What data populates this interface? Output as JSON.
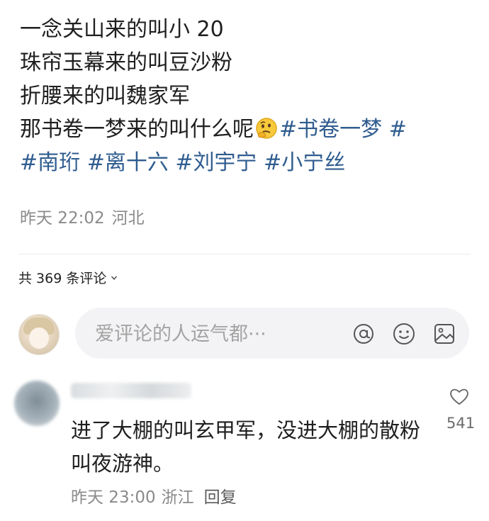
{
  "post": {
    "line1": "一念关山来的叫小 20",
    "line2": "珠帘玉幕来的叫豆沙粉",
    "line3": "折腰来的叫魏家军",
    "line4_text": "那书卷一梦来的叫什么呢",
    "tags": [
      "#书卷一梦",
      "#南珩",
      "#离十六",
      "#刘宇宁",
      "#小宁丝"
    ],
    "date": "昨天 22:02",
    "location": "河北"
  },
  "comments_header": {
    "count_label": "共 369 条评论"
  },
  "comment_input": {
    "placeholder": "爱评论的人运气都···"
  },
  "comment": {
    "text": "进了大棚的叫玄甲军，没进大棚的散粉叫夜游神。",
    "time": "昨天 23:00",
    "location": "浙江",
    "reply_label": "回复",
    "likes": "541"
  },
  "icons": {
    "emoji": "thinking-face-icon",
    "mention": "at-icon",
    "smile": "smile-icon",
    "image": "image-icon",
    "like": "heart-icon",
    "chevron": "chevron-down-icon"
  },
  "colors": {
    "hashtag": "#2f5c8f",
    "meta": "#8a8a8a",
    "input_bg": "#f3f3f5"
  }
}
